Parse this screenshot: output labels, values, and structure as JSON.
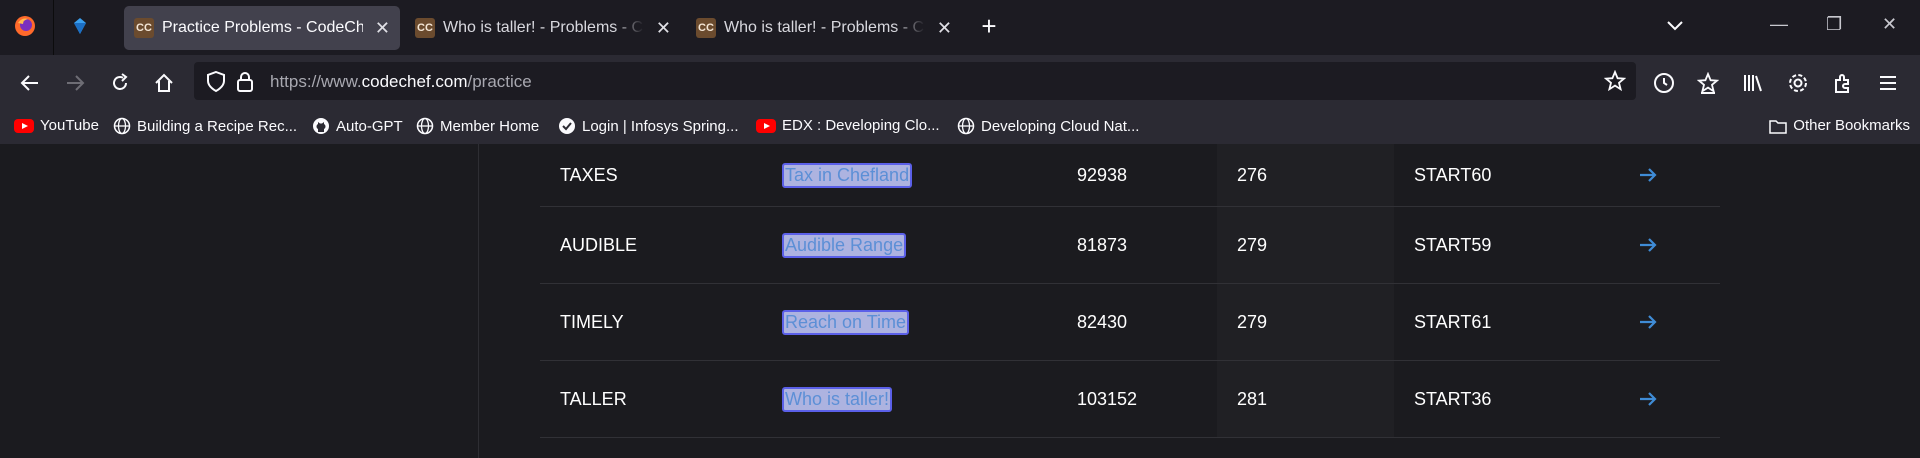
{
  "browser": {
    "tabs": [
      {
        "title": "Practice Problems - CodeChef",
        "active": true
      },
      {
        "title": "Who is taller! - Problems - CodeChef",
        "active": false
      },
      {
        "title": "Who is taller! - Problems - CodeChef",
        "active": false
      }
    ],
    "url": {
      "scheme": "https://www.",
      "host": "codechef.com",
      "path": "/practice"
    },
    "bookmarks": [
      "YouTube",
      "Building a Recipe Rec...",
      "Auto-GPT",
      "Member Home",
      "Login | Infosys Spring...",
      "EDX : Developing Clo...",
      "Developing Cloud Nat..."
    ],
    "other_bookmarks": "Other Bookmarks"
  },
  "problems": [
    {
      "code": "TAXES",
      "name": "Tax in Chefland",
      "submissions": "92938",
      "rating": "276",
      "contest": "START60"
    },
    {
      "code": "AUDIBLE",
      "name": "Audible Range",
      "submissions": "81873",
      "rating": "279",
      "contest": "START59"
    },
    {
      "code": "TIMELY",
      "name": "Reach on Time",
      "submissions": "82430",
      "rating": "279",
      "contest": "START61"
    },
    {
      "code": "TALLER",
      "name": "Who is taller!",
      "submissions": "103152",
      "rating": "281",
      "contest": "START36"
    }
  ],
  "colors": {
    "accent": "#3f8cd6",
    "selection": "#5b60e8"
  }
}
